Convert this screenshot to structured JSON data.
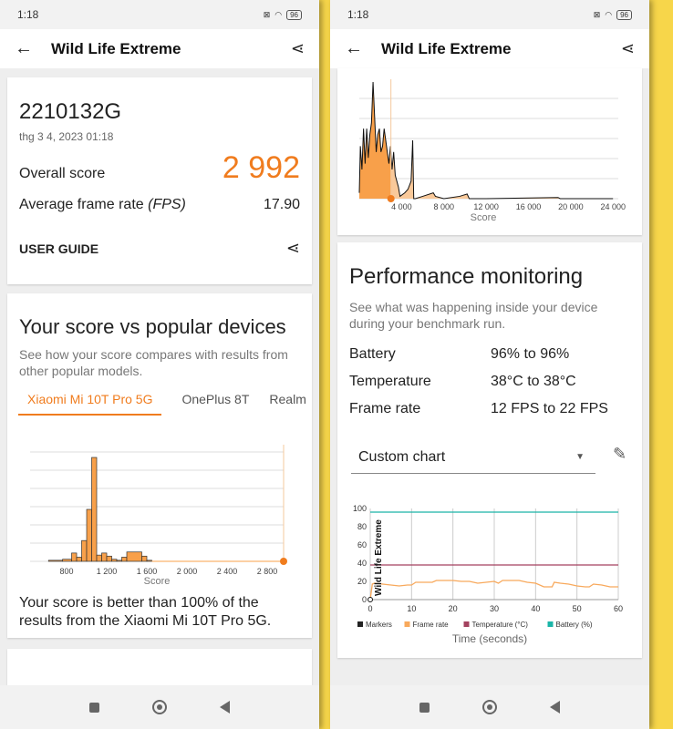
{
  "status": {
    "time": "1:18",
    "battery": "96"
  },
  "appbar": {
    "title": "Wild Life Extreme"
  },
  "result": {
    "device": "2210132G",
    "date": "thg 3 4, 2023 01:18",
    "overall_label": "Overall score",
    "overall_value": "2 992",
    "fps_label": "Average frame rate ",
    "fps_unit": "(FPS)",
    "fps_value": "17.90",
    "user_guide": "USER GUIDE"
  },
  "compare": {
    "title": "Your score vs popular devices",
    "desc": "See how your score compares with results from other popular models.",
    "tabs": [
      "Xiaomi Mi 10T Pro 5G",
      "OnePlus 8T",
      "Realm"
    ],
    "active_tab": 0,
    "summary": "Your score is better than 100% of the results from the Xiaomi Mi 10T Pro 5G."
  },
  "perf": {
    "title": "Performance monitoring",
    "desc": "See what was happening inside your device during your benchmark run.",
    "rows": [
      {
        "label": "Battery",
        "value": "96% to 96%"
      },
      {
        "label": "Temperature",
        "value": "38°C to 38°C"
      },
      {
        "label": "Frame rate",
        "value": "12 FPS to 22 FPS"
      }
    ],
    "dropdown": "Custom chart"
  },
  "colors": {
    "accent": "#f07c1e",
    "histogram": "#f8a04a",
    "frame_rate": "#f8a95c",
    "temperature": "#a3425f",
    "battery": "#1bb5a8",
    "background": "#f7d64a"
  },
  "chart_data": [
    {
      "type": "bar",
      "name": "compare-histogram",
      "xlabel": "Score",
      "xticks": [
        800,
        1200,
        1600,
        2000,
        2400,
        2800
      ],
      "xlim": [
        436,
        2964
      ],
      "your_score": 2992,
      "bins": [
        [
          620,
          760,
          0.01
        ],
        [
          760,
          850,
          0.02
        ],
        [
          850,
          900,
          0.08
        ],
        [
          900,
          950,
          0.04
        ],
        [
          950,
          1000,
          0.2
        ],
        [
          1000,
          1050,
          0.5
        ],
        [
          1050,
          1100,
          1.0
        ],
        [
          1100,
          1150,
          0.06
        ],
        [
          1150,
          1200,
          0.08
        ],
        [
          1200,
          1250,
          0.05
        ],
        [
          1250,
          1300,
          0.02
        ],
        [
          1300,
          1350,
          0.01
        ],
        [
          1350,
          1400,
          0.04
        ],
        [
          1400,
          1550,
          0.09
        ],
        [
          1550,
          1600,
          0.05
        ],
        [
          1600,
          1650,
          0.01
        ]
      ]
    },
    {
      "type": "area",
      "name": "global-histogram",
      "xlabel": "Score",
      "xticks": [
        4000,
        8000,
        12000,
        16000,
        20000,
        24000
      ],
      "xlim": [
        0,
        24500
      ],
      "your_score": 2992,
      "x": [
        0,
        100,
        250,
        400,
        550,
        700,
        850,
        1000,
        1150,
        1300,
        1450,
        1600,
        1750,
        1900,
        2050,
        2200,
        2350,
        2500,
        2650,
        2800,
        2950,
        3100,
        3250,
        3400,
        3550,
        3700,
        3850,
        4000,
        4300,
        4600,
        4900,
        5050,
        5150,
        5300,
        6000,
        7000,
        7200,
        8000,
        9500,
        10200,
        10400,
        12000,
        18800,
        19000,
        24000
      ],
      "y": [
        0.05,
        0.45,
        0.25,
        0.6,
        0.3,
        0.6,
        0.35,
        0.55,
        0.65,
        1.0,
        0.7,
        0.4,
        0.55,
        0.6,
        0.4,
        0.45,
        0.6,
        0.5,
        0.4,
        0.3,
        0.45,
        0.25,
        0.4,
        0.2,
        0.15,
        0.1,
        0.02,
        0.03,
        0.05,
        0.08,
        0.15,
        0.5,
        0.0,
        0.0,
        0.02,
        0.05,
        0.02,
        0.0,
        0.02,
        0.04,
        0.0,
        0.0,
        0.01,
        0.0,
        0.0
      ]
    },
    {
      "type": "line",
      "name": "performance-chart",
      "xlabel": "Time (seconds)",
      "xlim": [
        0,
        60
      ],
      "ylim": [
        0,
        100
      ],
      "xticks": [
        0,
        10,
        20,
        30,
        40,
        50,
        60
      ],
      "yticks": [
        0,
        20,
        40,
        60,
        80,
        100
      ],
      "marker_label": "Wild Life Extreme",
      "legend": [
        "Markers",
        "Frame rate",
        "Temperature (°C)",
        "Battery (%)"
      ],
      "series": [
        {
          "name": "Frame rate",
          "x": [
            0,
            0.5,
            1,
            3,
            5,
            7,
            9,
            10,
            11,
            13,
            15,
            16,
            18,
            20,
            22,
            24,
            26,
            28,
            30,
            31,
            32,
            34,
            36,
            38,
            40,
            42,
            44,
            44.5,
            46,
            48,
            50,
            52,
            53,
            54,
            56,
            58,
            60
          ],
          "y": [
            0,
            17,
            18,
            17,
            16,
            15,
            16,
            16,
            19,
            19,
            19,
            21,
            21,
            21,
            20,
            20,
            18,
            19,
            20,
            18,
            21,
            21,
            21,
            19,
            18,
            14,
            14,
            19,
            18,
            17,
            15,
            14,
            14,
            17,
            16,
            14,
            14
          ]
        },
        {
          "name": "Temperature (°C)",
          "x": [
            0,
            60
          ],
          "y": [
            38,
            38
          ]
        },
        {
          "name": "Battery (%)",
          "x": [
            0,
            60
          ],
          "y": [
            96,
            96
          ]
        }
      ]
    }
  ]
}
